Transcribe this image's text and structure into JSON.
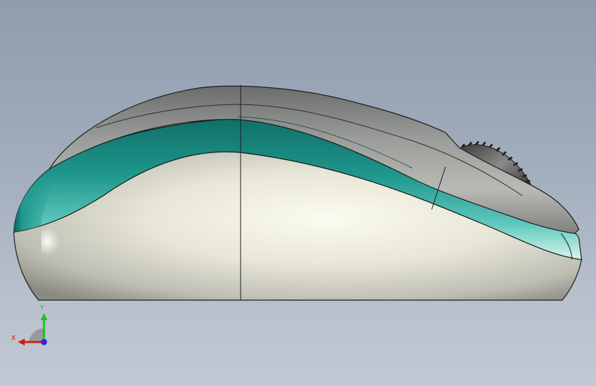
{
  "viewport": {
    "background_top": "#8e9cae",
    "background_bottom": "#c2c9d4"
  },
  "model": {
    "body_color": "#e8e8dc",
    "shell_color": "#8d8f8c",
    "stripe_color": "#1f8f86",
    "wheel_color": "#555555",
    "edge_color": "#1a1a1a"
  },
  "triad": {
    "x_label": "X",
    "y_label": "Y",
    "x_color": "#d11a1a",
    "y_color": "#1fbf1f",
    "z_color": "#2a2ad6"
  }
}
